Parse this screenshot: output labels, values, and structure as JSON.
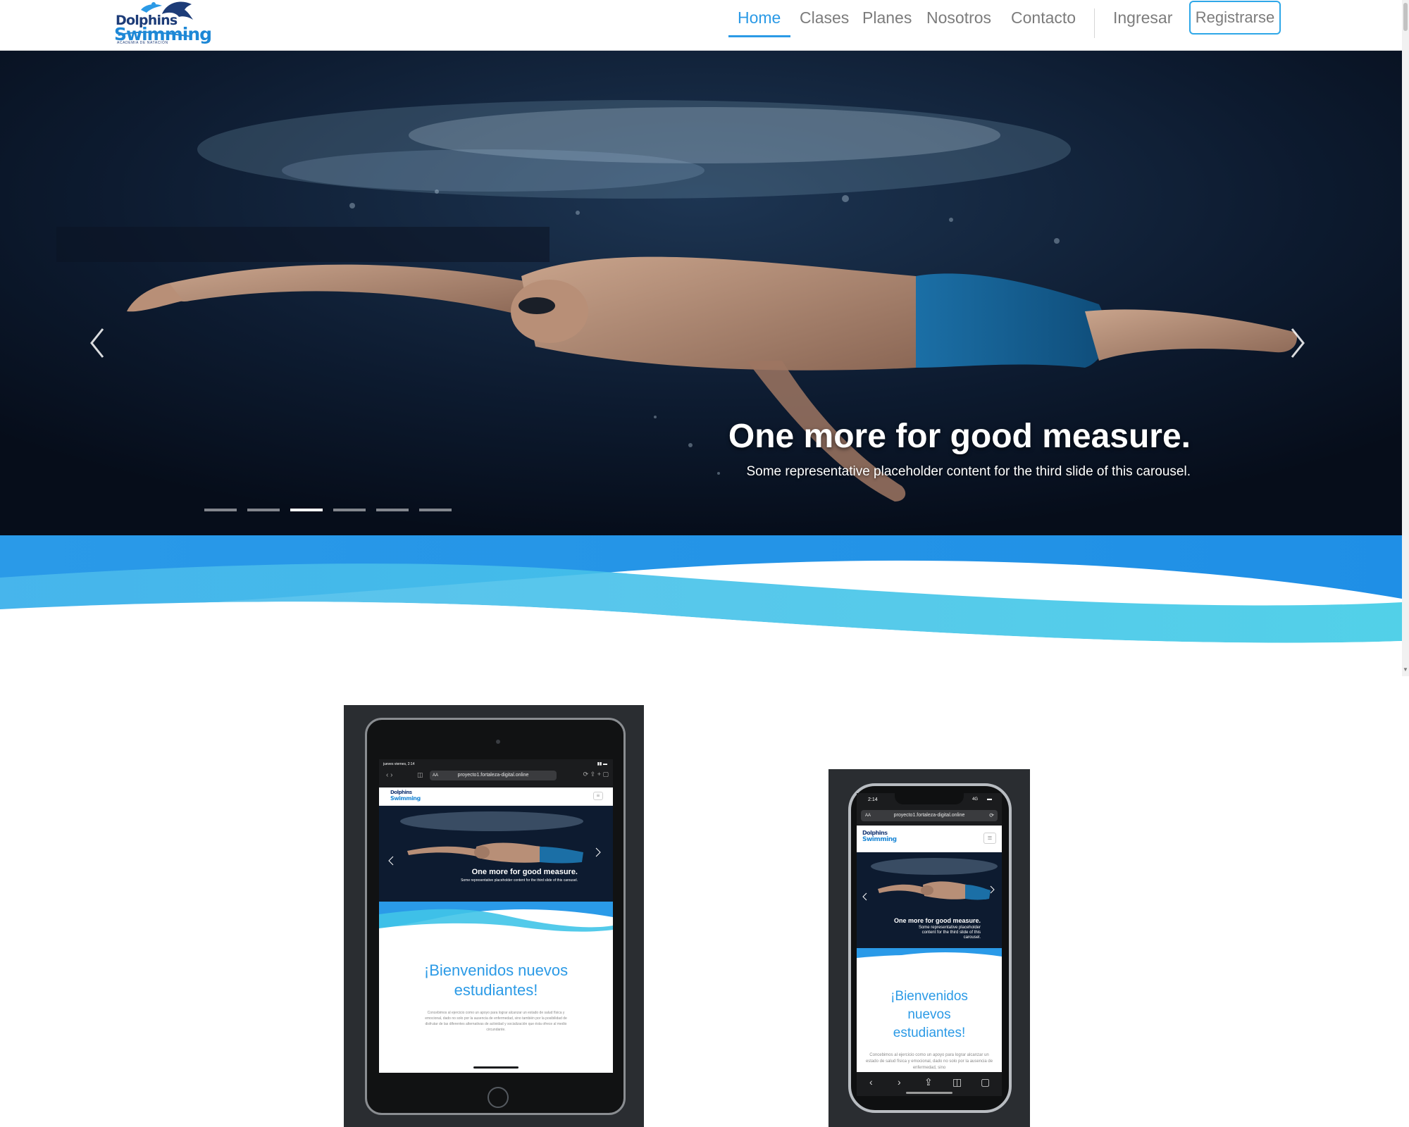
{
  "brand": {
    "name_line1": "Dolphins",
    "name_line2": "Swimming",
    "tagline": "ACADEMIA DE NATACIÓN"
  },
  "nav": {
    "items": [
      {
        "label": "Home",
        "active": true
      },
      {
        "label": "Clases",
        "active": false
      },
      {
        "label": "Planes",
        "active": false
      },
      {
        "label": "Nosotros",
        "active": false
      },
      {
        "label": "Contacto",
        "active": false
      }
    ],
    "login_label": "Ingresar",
    "register_label": "Registrarse"
  },
  "hero": {
    "title": "One more for good measure.",
    "text": "Some representative placeholder content for the third slide of this carousel.",
    "slide_count": 6,
    "active_slide": 3,
    "prev_icon": "chevron-left-icon",
    "next_icon": "chevron-right-icon"
  },
  "mockup": {
    "tablet": {
      "status_text": "jueves viernes, 2:14",
      "url": "proyecto1.fortaleza-digital.online",
      "url_prefix": "AA",
      "caption_title": "One more for good measure.",
      "caption_text": "Some representative placeholder content for the third slide of this carousel.",
      "welcome": "¡Bienvenidos nuevos estudiantes!",
      "body": "Concebimos al ejercicio como un apoyo para lograr alcanzar un estado de salud física y emocional, dado no solo por la ausencia de enfermedad, sino también por la posibilidad de disfrutar de las diferentes alternativas de actividad y socialización que ésta ofrece al medio circundante."
    },
    "phone": {
      "status_time": "2:14",
      "status_signal": "4G",
      "url": "proyecto1.fortaleza-digital.online",
      "url_prefix": "AA",
      "caption_title": "One more for good measure.",
      "caption_text": "Some representative placeholder content for the third slide of this carousel.",
      "welcome": "¡Bienvenidos nuevos estudiantes!",
      "body": "Concebimos al ejercicio como un apoyo para lograr alcanzar un estado de salud física y emocional, dado no solo por la ausencia de enfermedad, sino"
    }
  },
  "colors": {
    "accent": "#2b9ae6",
    "wave_dark": "#1f8fe6",
    "wave_light": "#40c4e8",
    "hero_bg": "#0a1526"
  }
}
